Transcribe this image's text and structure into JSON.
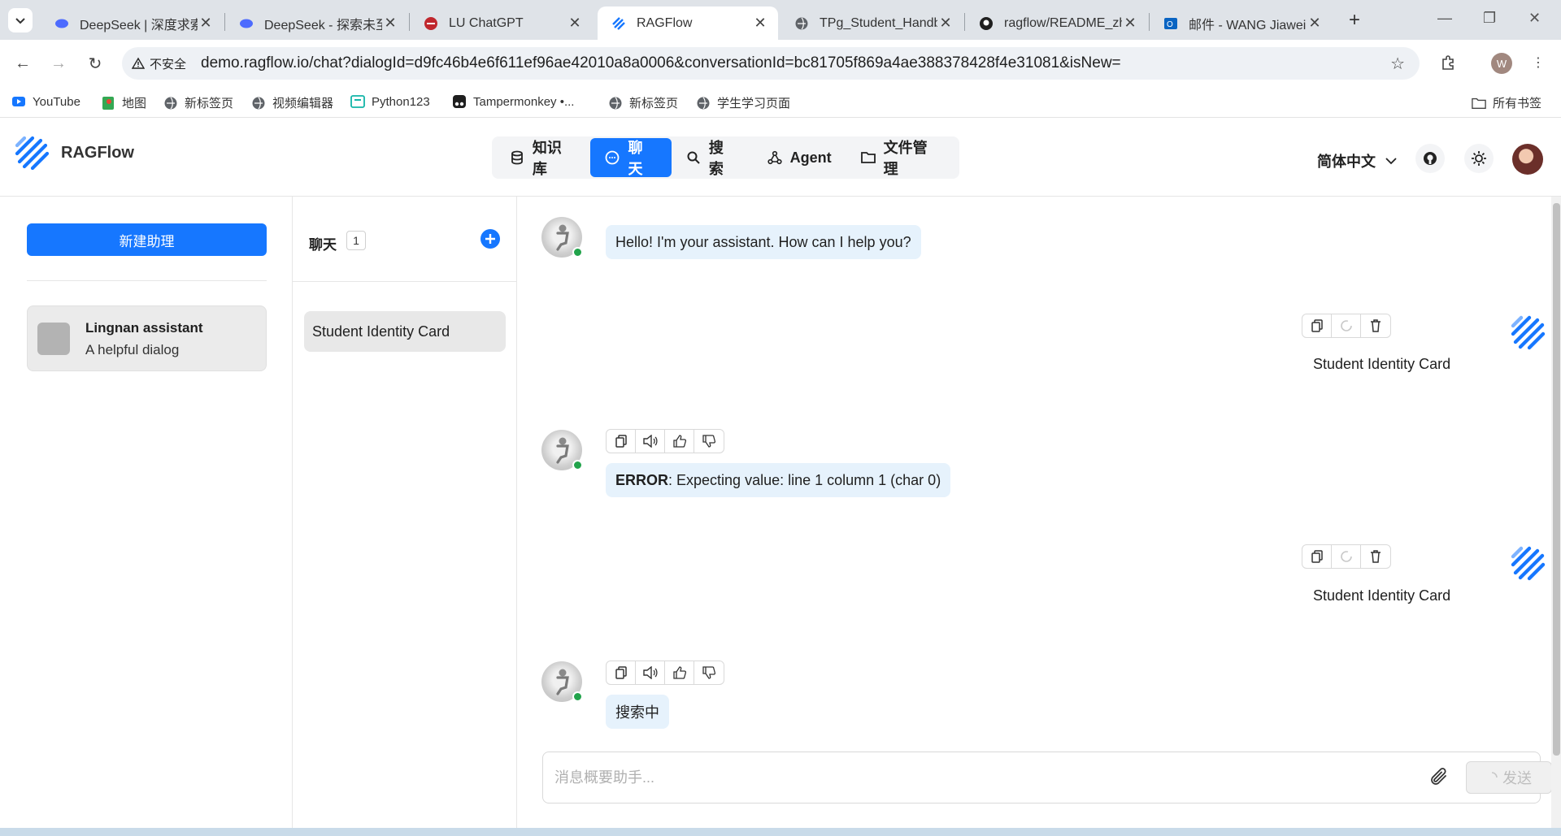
{
  "browser": {
    "tabs": [
      {
        "title": "DeepSeek | 深度求索",
        "active": false
      },
      {
        "title": "DeepSeek - 探索未至之境",
        "active": false
      },
      {
        "title": "LU ChatGPT",
        "active": false
      },
      {
        "title": "RAGFlow",
        "active": true
      },
      {
        "title": "TPg_Student_Handbook",
        "active": false
      },
      {
        "title": "ragflow/README_zh.md",
        "active": false
      },
      {
        "title": "邮件 - WANG Jiawei",
        "active": false
      }
    ],
    "insecure_label": "不安全",
    "url": "demo.ragflow.io/chat?dialogId=d9fc46b4e6f611ef96ae42010a8a0006&conversationId=bc81705f869a4ae388378428f4e31081&isNew=",
    "profile_initial": "W",
    "bookmarks": [
      "YouTube",
      "地图",
      "新标签页",
      "视频编辑器",
      "Python123",
      "Tampermonkey •...",
      "新标签页",
      "学生学习页面"
    ],
    "all_bookmarks": "所有书签"
  },
  "app": {
    "brand": "RAGFlow",
    "nav": [
      {
        "label": "知识库",
        "icon": "database-icon",
        "active": false
      },
      {
        "label": "聊天",
        "icon": "chat-icon",
        "active": true
      },
      {
        "label": "搜索",
        "icon": "search-icon",
        "active": false
      },
      {
        "label": "Agent",
        "icon": "graph-icon",
        "active": false
      },
      {
        "label": "文件管理",
        "icon": "folder-icon",
        "active": false
      }
    ],
    "language": "简体中文",
    "accent_color": "#1677ff"
  },
  "assistants": {
    "new_button": "新建助理",
    "items": [
      {
        "name": "Lingnan assistant",
        "description": "A helpful dialog"
      }
    ]
  },
  "conversations": {
    "title": "聊天",
    "count": "1",
    "items": [
      {
        "title": "Student Identity Card"
      }
    ]
  },
  "messages": [
    {
      "role": "assistant",
      "text": "Hello! I'm your assistant. How can I help you?"
    },
    {
      "role": "user",
      "text": "Student Identity Card"
    },
    {
      "role": "assistant",
      "error_label": "ERROR",
      "text": ": Expecting value: line 1 column 1 (char 0)"
    },
    {
      "role": "user",
      "text": "Student Identity Card"
    },
    {
      "role": "assistant",
      "text": "搜索中"
    }
  ],
  "composer": {
    "placeholder": "消息概要助手...",
    "send_label": "发送"
  }
}
